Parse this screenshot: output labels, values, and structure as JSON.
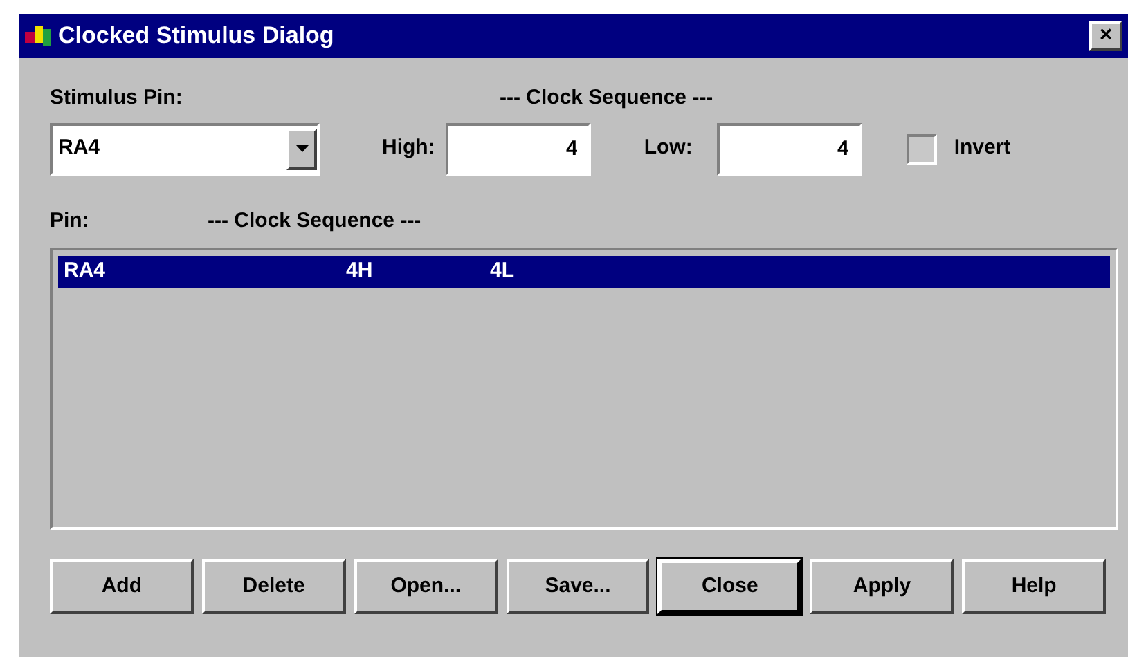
{
  "window": {
    "title": "Clocked Stimulus Dialog",
    "close": "×"
  },
  "stimulus_pin": {
    "label": "Stimulus Pin:",
    "value": "RA4"
  },
  "clock_sequence": {
    "heading": "--- Clock Sequence ---",
    "high_label": "High:",
    "high_value": "4",
    "low_label": "Low:",
    "low_value": "4",
    "invert": {
      "label": "Invert",
      "checked": false
    }
  },
  "list": {
    "columns": [
      "Pin:",
      "--- Clock Sequence ---"
    ],
    "rows": [
      {
        "pin": "RA4",
        "high": "4H",
        "low": "4L",
        "selected": true
      }
    ]
  },
  "buttons": [
    {
      "label": "Add",
      "default": false
    },
    {
      "label": "Delete",
      "default": false
    },
    {
      "label": "Open...",
      "default": false
    },
    {
      "label": "Save...",
      "default": false
    },
    {
      "label": "Close",
      "default": true
    },
    {
      "label": "Apply",
      "default": false
    },
    {
      "label": "Help",
      "default": false
    }
  ]
}
